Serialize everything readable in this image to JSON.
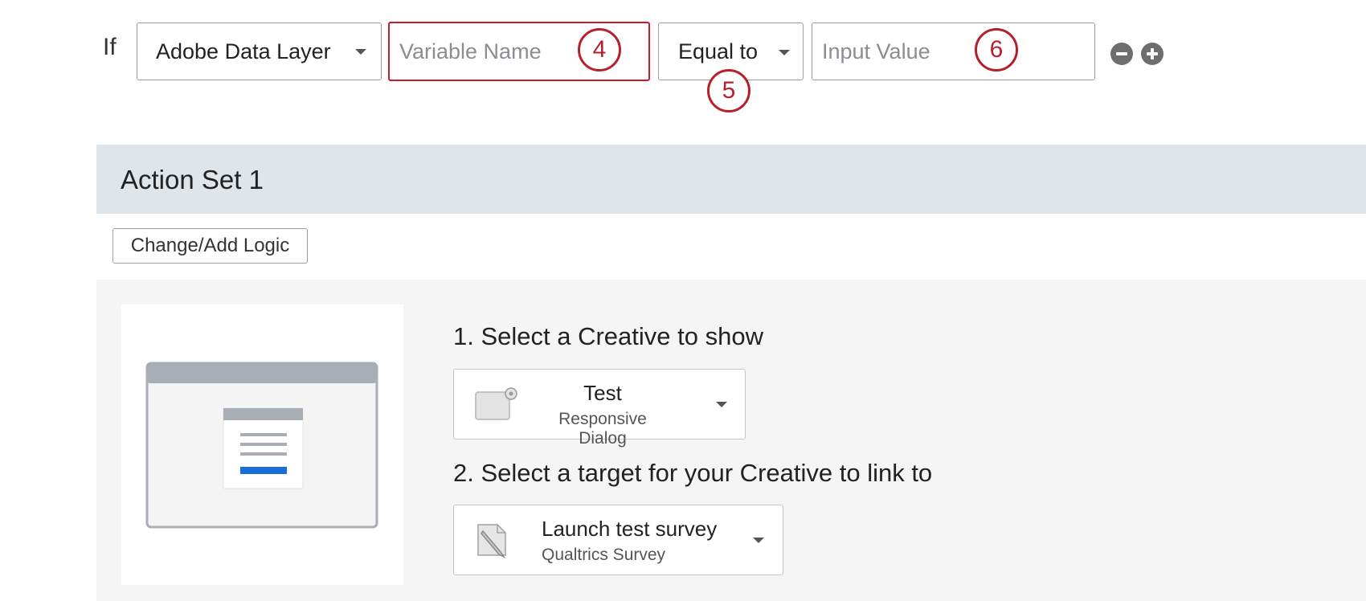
{
  "condition": {
    "if_label": "If",
    "source_select": "Adobe Data Layer",
    "variable_placeholder": "Variable Name",
    "operator_select": "Equal to",
    "value_placeholder": "Input Value",
    "badges": {
      "variable": "4",
      "operator": "5",
      "value": "6"
    },
    "icons": {
      "remove": "minus-circle-icon",
      "add": "plus-circle-icon"
    }
  },
  "action_set": {
    "title": "Action Set 1",
    "logic_button": "Change/Add Logic",
    "step1_label": "1. Select a Creative to show",
    "creative": {
      "title": "Test",
      "subtitle": "Responsive Dialog",
      "icon": "dialog-icon"
    },
    "step2_label": "2. Select a target for your Creative to link to",
    "target": {
      "title": "Launch test survey",
      "subtitle": "Qualtrics Survey",
      "icon": "survey-edit-icon"
    }
  },
  "colors": {
    "accent_red": "#b5202a",
    "header_bg": "#e0e5ea",
    "panel_bg": "#f5f5f5",
    "preview_accent": "#1a6ed8"
  }
}
